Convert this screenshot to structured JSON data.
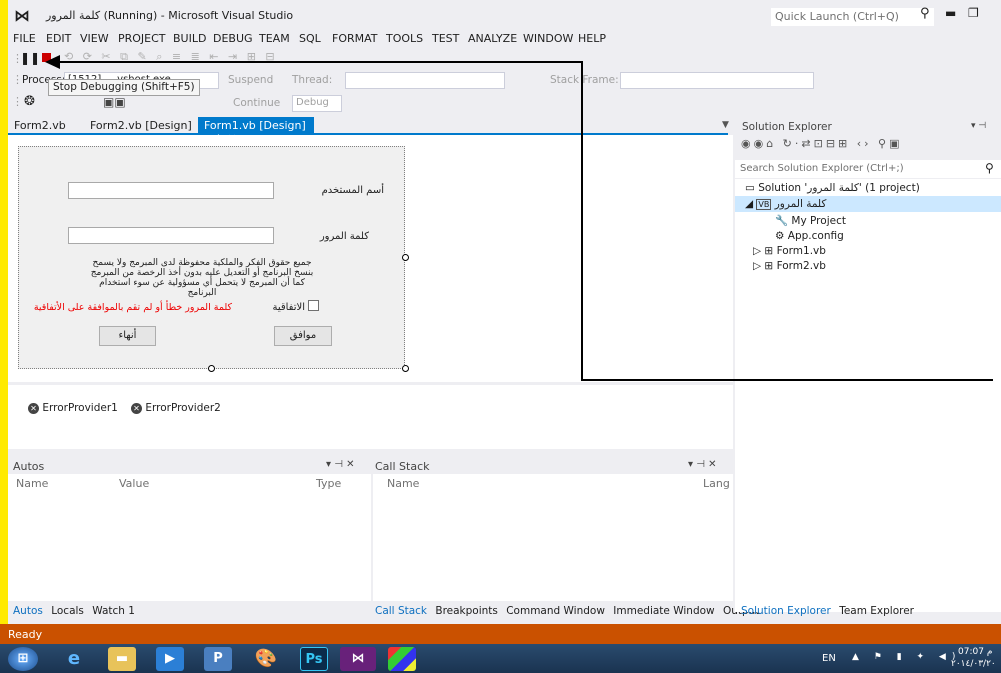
{
  "window": {
    "title": "كلمة المرور (Running) - Microsoft Visual Studio",
    "quick_launch_placeholder": "Quick Launch (Ctrl+Q)"
  },
  "menu": [
    "FILE",
    "EDIT",
    "VIEW",
    "PROJECT",
    "BUILD",
    "DEBUG",
    "TEAM",
    "SQL",
    "FORMAT",
    "TOOLS",
    "TEST",
    "ANALYZE",
    "WINDOW",
    "HELP"
  ],
  "toolbar": {
    "process_label": "Process:",
    "process_value": "[1512] ... vshost.exe",
    "suspend": "Suspend",
    "thread": "Thread:",
    "stack_frame": "Stack Frame:",
    "continue": "Continue",
    "config": "Debug",
    "tooltip": "Stop Debugging (Shift+F5)"
  },
  "doc_tabs": [
    "Form2.vb",
    "Form2.vb [Design]",
    "Form1.vb [Design]"
  ],
  "form": {
    "username_label": "أسم المستخدم",
    "password_label": "كلمة المرور",
    "notice": "جميع حقوق الفكر والملكية محفوظة لدى المبرمج ولا يسمح بنسخ البرنامج أو التعديل عليه بدون أخذ الرخصة من المبرمج كما أن المبرمج لا يتحمل أي مسؤولية عن سوء استخدام البرنامج",
    "agreement_label": "الاتفاقية",
    "error_text": "كلمة المرور خطأ أو لم تقم بالموافقة على الأتفاقية",
    "ok_button": "موافق",
    "end_button": "أنهاء"
  },
  "tray": [
    "ErrorProvider1",
    "ErrorProvider2"
  ],
  "autos": {
    "title": "Autos",
    "columns": [
      "Name",
      "Value",
      "Type"
    ],
    "tabs": [
      "Autos",
      "Locals",
      "Watch 1"
    ]
  },
  "callstack": {
    "title": "Call Stack",
    "columns": [
      "Name",
      "Lang"
    ],
    "tabs": [
      "Call Stack",
      "Breakpoints",
      "Command Window",
      "Immediate Window",
      "Output"
    ]
  },
  "solution_explorer": {
    "title": "Solution Explorer",
    "search_placeholder": "Search Solution Explorer (Ctrl+;)",
    "solution": "Solution 'كلمة المرور' (1 project)",
    "project": "كلمة المرور",
    "items": [
      "My Project",
      "App.config",
      "Form1.vb",
      "Form2.vb"
    ],
    "tabs": [
      "Solution Explorer",
      "Team Explorer"
    ]
  },
  "status": "Ready",
  "taskbar": {
    "lang": "EN",
    "time": "07:07 م",
    "date": "٢٠١٤/٠٣/٢٠"
  }
}
